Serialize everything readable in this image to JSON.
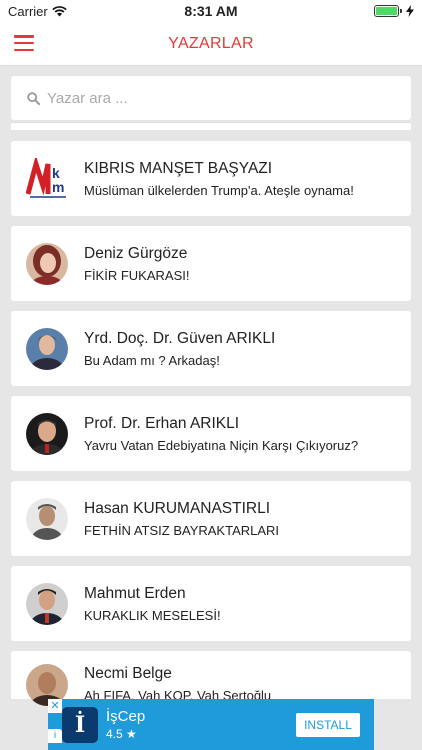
{
  "status_bar": {
    "carrier": "Carrier",
    "time": "8:31 AM"
  },
  "nav": {
    "title": "YAZARLAR",
    "menu_icon": "hamburger-menu-icon"
  },
  "search": {
    "placeholder": "Yazar ara ..."
  },
  "authors": [
    {
      "name": "KIBRIS MANŞET BAŞYAZI",
      "title": "Müslüman ülkelerden Trump'a. Ateşle oynama!",
      "logo_text": "k m"
    },
    {
      "name": "Deniz Gürgöze",
      "title": "FİKİR FUKARASI!"
    },
    {
      "name": "Yrd. Doç. Dr. Güven ARIKLI",
      "title": "Bu Adam mı ? Arkadaş!"
    },
    {
      "name": "Prof. Dr. Erhan ARIKLI",
      "title": "Yavru Vatan Edebiyatına Niçin Karşı Çıkıyoruz?"
    },
    {
      "name": "Hasan KURUMANASTIRLI",
      "title": "FETHİN ATSIZ BAYRAKTARLARI"
    },
    {
      "name": "Mahmut Erden",
      "title": "KURAKLIK MESELESİ!"
    },
    {
      "name": "Necmi Belge",
      "title": "Ah FIFA, Vah KOP, Vah Sertoğlu"
    }
  ],
  "ad": {
    "app_name": "İşCep",
    "rating": "4.5 ★",
    "install_label": "INSTALL",
    "logo_char": "İ"
  },
  "colors": {
    "accent": "#e53935",
    "ad_blue": "#1e9bd8",
    "background": "#e6e6e6"
  }
}
